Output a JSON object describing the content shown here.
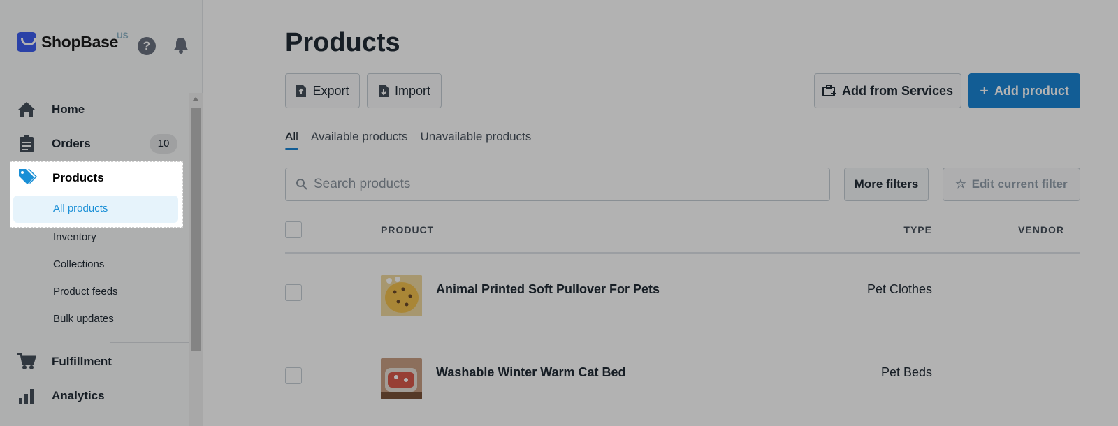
{
  "brand": {
    "name": "ShopBase",
    "region": "US"
  },
  "sidebar": {
    "items": [
      {
        "label": "Home",
        "icon": "home-icon"
      },
      {
        "label": "Orders",
        "icon": "clipboard-icon",
        "badge": "10"
      },
      {
        "label": "Products",
        "icon": "tag-icon",
        "active": true
      },
      {
        "label": "Fulfillment",
        "icon": "cart-icon"
      },
      {
        "label": "Analytics",
        "icon": "bar-chart-icon"
      }
    ],
    "products_sub": [
      {
        "label": "All products",
        "active": true
      },
      {
        "label": "Inventory"
      },
      {
        "label": "Collections"
      },
      {
        "label": "Product feeds"
      },
      {
        "label": "Bulk updates"
      }
    ]
  },
  "main": {
    "title": "Products",
    "actions": {
      "export": "Export",
      "import": "Import",
      "add_from_services": "Add from Services",
      "add_product": "Add product"
    },
    "tabs": [
      {
        "label": "All",
        "active": true
      },
      {
        "label": "Available products"
      },
      {
        "label": "Unavailable products"
      }
    ],
    "search": {
      "placeholder": "Search products"
    },
    "filters": {
      "more": "More filters",
      "edit": "Edit current filter"
    },
    "table": {
      "headers": {
        "product": "PRODUCT",
        "type": "TYPE",
        "vendor": "VENDOR"
      },
      "rows": [
        {
          "name": "Animal Printed Soft Pullover For Pets",
          "type": "Pet Clothes",
          "vendor": ""
        },
        {
          "name": "Washable Winter Warm Cat Bed",
          "type": "Pet Beds",
          "vendor": ""
        }
      ]
    }
  },
  "colors": {
    "primary": "#1a86d6",
    "active_link": "#1a8fd6",
    "brand": "#3d5ef0"
  }
}
